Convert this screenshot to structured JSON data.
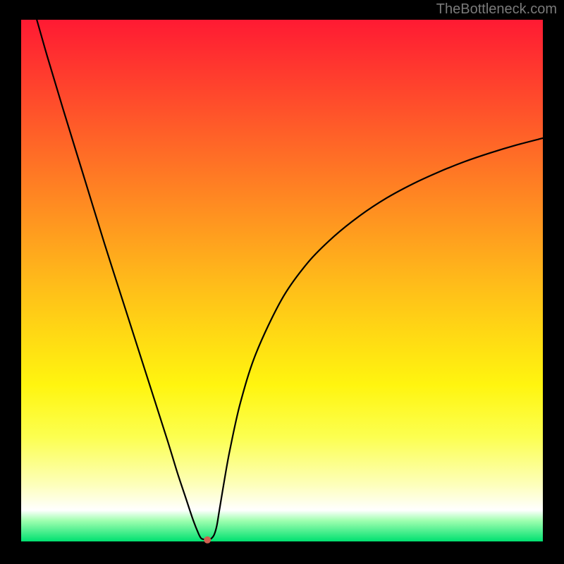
{
  "watermark": "TheBottleneck.com",
  "colors": {
    "background": "#000000",
    "curve": "#000000",
    "marker": "#d06050"
  },
  "chart_data": {
    "type": "line",
    "title": "",
    "xlabel": "",
    "ylabel": "",
    "xlim": [
      0,
      100
    ],
    "ylim": [
      0,
      100
    ],
    "grid": false,
    "annotations": [],
    "series": [
      {
        "name": "bottleneck-curve",
        "x": [
          3,
          5,
          8,
          12,
          16,
          20,
          24,
          28,
          30,
          31.5,
          33,
          34,
          34.5,
          35,
          36,
          36.5,
          37,
          37.5,
          38,
          39,
          40,
          42,
          45,
          50,
          55,
          60,
          65,
          70,
          75,
          80,
          85,
          90,
          95,
          100
        ],
        "y": [
          100,
          93,
          83,
          70,
          57,
          44.5,
          32,
          19.5,
          13,
          8.5,
          4,
          1.5,
          0.6,
          0.4,
          0.4,
          0.6,
          1.3,
          3,
          6,
          12,
          17.5,
          26.5,
          36,
          46.5,
          53.5,
          58.5,
          62.5,
          65.8,
          68.5,
          70.8,
          72.8,
          74.5,
          76,
          77.3
        ]
      }
    ],
    "minimum_point": {
      "x": 35.7,
      "y": 0.3
    },
    "flat_bottom": {
      "x0": 34.3,
      "x1": 36.2,
      "y": 0.35
    }
  }
}
